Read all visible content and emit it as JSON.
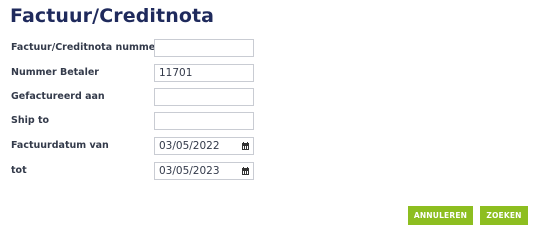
{
  "page": {
    "title": "Factuur/Creditnota"
  },
  "form": {
    "fields": [
      {
        "label": "Factuur/Creditnota nummer",
        "value": ""
      },
      {
        "label": "Nummer Betaler",
        "value": "11701"
      },
      {
        "label": "Gefactureerd aan",
        "value": ""
      },
      {
        "label": "Ship to",
        "value": ""
      },
      {
        "label": "Factuurdatum van",
        "value": "03/05/2022",
        "icon": "calendar-icon"
      },
      {
        "label": "tot",
        "value": "03/05/2023",
        "icon": "calendar-icon"
      }
    ]
  },
  "actions": {
    "cancel_label": "ANNULEREN",
    "search_label": "ZOEKEN"
  },
  "colors": {
    "title": "#1f2a5c",
    "button": "#8dbe20",
    "button_text": "#ffffff",
    "field_border": "#c9ccd3"
  }
}
